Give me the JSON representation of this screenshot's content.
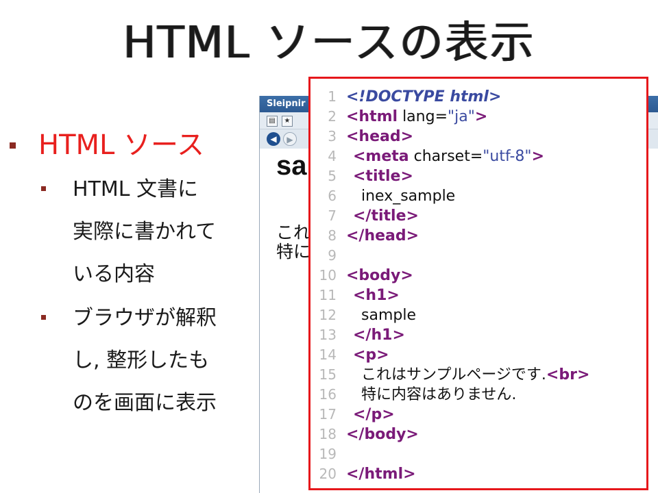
{
  "slide": {
    "title": "HTML ソースの表示",
    "bullet_main": "HTML ソース",
    "sub_bullets": [
      [
        "HTML 文書に",
        "実際に書かれて",
        "いる内容"
      ],
      [
        "ブラウザが解釈",
        "し, 整形したも",
        "のを画面に表示"
      ]
    ]
  },
  "browser": {
    "title": "Sleipnir",
    "page_heading": "sa",
    "page_lines": [
      "これ",
      "特に"
    ]
  },
  "code": {
    "numbers": [
      "1",
      "2",
      "3",
      "4",
      "5",
      "6",
      "7",
      "8",
      "9",
      "10",
      "11",
      "12",
      "13",
      "14",
      "15",
      "16",
      "17",
      "18",
      "19",
      "20"
    ],
    "l1": "<!DOCTYPE html>",
    "l2_tag": "<html",
    "l2_attr": " lang=",
    "l2_val": "\"ja\"",
    "l2_end": ">",
    "l3": "<head>",
    "l4_tag": "<meta",
    "l4_attr": " charset=",
    "l4_val": "\"utf-8\"",
    "l4_end": ">",
    "l5": "<title>",
    "l6": "inex_sample",
    "l7": "</title>",
    "l8": "</head>",
    "l10": "<body>",
    "l11": "<h1>",
    "l12": "sample",
    "l13": "</h1>",
    "l14": "<p>",
    "l15_text": "これはサンプルページです.",
    "l15_tag": "<br>",
    "l16": "特に内容はありません.",
    "l17": "</p>",
    "l18": "</body>",
    "l20": "</html>"
  },
  "colors": {
    "accent_red": "#e8201e",
    "bullet": "#8b2a22",
    "panel_border": "#e6171b",
    "tag": "#7a1a78",
    "value": "#3a4aa0"
  }
}
